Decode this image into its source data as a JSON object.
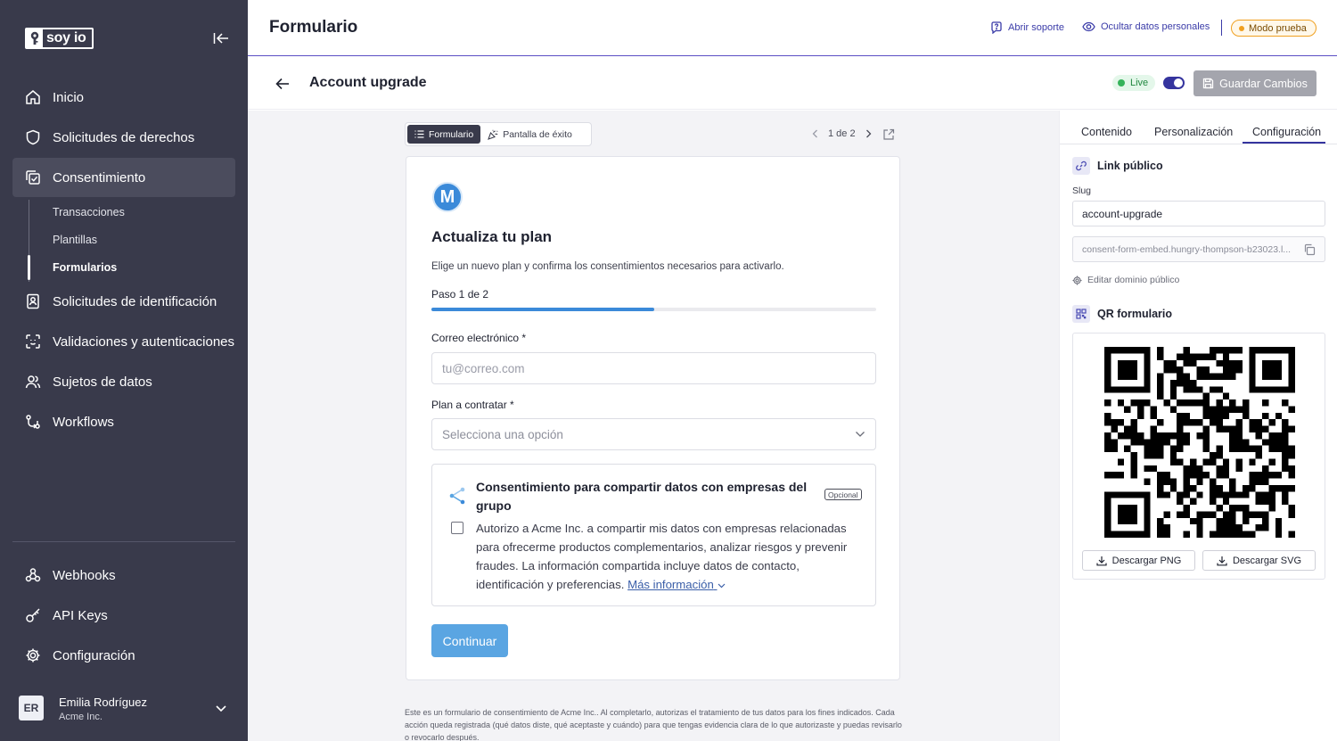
{
  "brand": {
    "logo_text": "soy io"
  },
  "sidebar": {
    "items": [
      {
        "label": "Inicio",
        "icon": "home-icon"
      },
      {
        "label": "Solicitudes de derechos",
        "icon": "shield-icon"
      },
      {
        "label": "Consentimiento",
        "icon": "consent-icon"
      },
      {
        "label": "Solicitudes de identificación",
        "icon": "id-card-icon"
      },
      {
        "label": "Validaciones y autenticaciones",
        "icon": "face-scan-icon"
      },
      {
        "label": "Sujetos de datos",
        "icon": "users-icon"
      },
      {
        "label": "Workflows",
        "icon": "workflow-icon"
      }
    ],
    "subitems": [
      "Transacciones",
      "Plantillas",
      "Formularios"
    ],
    "bottom_items": [
      {
        "label": "Webhooks",
        "icon": "webhook-icon"
      },
      {
        "label": "API Keys",
        "icon": "key-icon"
      },
      {
        "label": "Configuración",
        "icon": "gear-icon"
      }
    ],
    "user": {
      "initials": "ER",
      "name": "Emilia Rodríguez",
      "company": "Acme Inc."
    }
  },
  "header": {
    "title": "Formulario",
    "support": "Abrir soporte",
    "hide_data": "Ocultar datos personales",
    "mode": "Modo prueba"
  },
  "subheader": {
    "form_name": "Account upgrade",
    "live": "Live",
    "save": "Guardar Cambios"
  },
  "preview": {
    "tabs": [
      "Formulario",
      "Pantalla de éxito"
    ],
    "pager": "1 de 2"
  },
  "form": {
    "brand_initial": "M",
    "title": "Actualiza tu plan",
    "description": "Elige un nuevo plan y confirma los consentimientos necesarios para activarlo.",
    "step": "Paso 1 de 2",
    "progress": 0.5,
    "email_label": "Correo electrónico *",
    "email_placeholder": "tu@correo.com",
    "plan_label": "Plan a contratar *",
    "plan_placeholder": "Selecciona una opción",
    "consent_title": "Consentimiento para compartir datos con empresas del grupo",
    "optional": "Opcional",
    "consent_text": "Autorizo a Acme Inc. a compartir mis datos con empresas relacionadas para ofrecerme productos complementarios, analizar riesgos y prevenir fraudes. La información compartida incluye datos de contacto, identificación y preferencias.",
    "more_info": "Más información",
    "continue": "Continuar",
    "disclaimer": "Este es un formulario de consentimiento de Acme Inc.. Al completarlo, autorizas el tratamiento de tus datos para los fines indicados. Cada acción queda registrada (qué datos diste, qué aceptaste y cuándo) para que tengas evidencia clara de lo que autorizaste y puedas revisarlo o revocarlo después."
  },
  "panel": {
    "tabs": [
      "Contenido",
      "Personalización",
      "Configuración"
    ],
    "public_link": "Link público",
    "slug_label": "Slug",
    "slug_value": "account-upgrade",
    "url": "consent-form-embed.hungry-thompson-b23023.l...",
    "edit_domain": "Editar dominio público",
    "qr_title": "QR formulario",
    "download_png": "Descargar PNG",
    "download_svg": "Descargar SVG"
  },
  "colors": {
    "sidebar": "#393a4b",
    "accent": "#35349e",
    "brand_blue": "#3b8ad9",
    "live_green": "#35b35a",
    "warning": "#f0a020"
  }
}
